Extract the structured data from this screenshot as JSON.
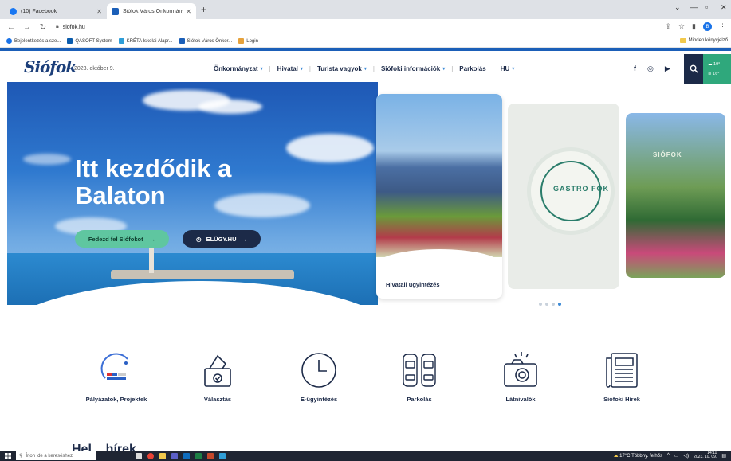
{
  "browser": {
    "tabs": [
      {
        "title": "(10) Facebook",
        "color": "#1877f2"
      },
      {
        "title": "Siófok Város Önkormányzata - ...",
        "color": "#1b5fb8"
      }
    ],
    "url": "siofok.hu",
    "bookmarks": [
      {
        "label": "Bejelentkezés a sze...",
        "color": "#1a73e8"
      },
      {
        "label": "QASOFT System",
        "color": "#0b5cad"
      },
      {
        "label": "KRÉTA Iskolai Alapr...",
        "color": "#2f9ed8"
      },
      {
        "label": "Siófok Város Önkor...",
        "color": "#1b5fb8"
      },
      {
        "label": "Login",
        "color": "#e6a23c"
      }
    ],
    "bookmarks_right": "Minden könyvjelző"
  },
  "header": {
    "logo": "Siófok",
    "date": "2023. október 9.",
    "nav": [
      {
        "label": "Önkormányzat",
        "dropdown": true
      },
      {
        "label": "Hivatal",
        "dropdown": true
      },
      {
        "label": "Turista vagyok",
        "dropdown": true
      },
      {
        "label": "Siófoki információk",
        "dropdown": true
      },
      {
        "label": "Parkolás",
        "dropdown": false
      },
      {
        "label": "HU",
        "dropdown": true
      }
    ],
    "weather": {
      "line1": "19°",
      "line2": "16°"
    }
  },
  "hero": {
    "title_line1": "Itt kezdődik a",
    "title_line2": "Balaton",
    "btn_primary": "Fedezd fel Siófokot",
    "btn_secondary": "ELÜGY.HU"
  },
  "cards": {
    "card1_caption": "Hivatali ügyintézés",
    "card2_logo": "GASTRO FOK",
    "card3_label": "SIÓFOK"
  },
  "slider": {
    "count": 4,
    "active": 3
  },
  "quick_links": [
    {
      "label": "Pályázatok, Projektek",
      "icon": "projects-logo-icon"
    },
    {
      "label": "Választás",
      "icon": "ballot-box-icon"
    },
    {
      "label": "E-ügyintézés",
      "icon": "clock-icon"
    },
    {
      "label": "Parkolás",
      "icon": "parking-cars-icon"
    },
    {
      "label": "Látnivalók",
      "icon": "camera-icon"
    },
    {
      "label": "Siófoki Hírek",
      "icon": "newspaper-icon"
    }
  ],
  "partial_section_title": "Hel... hírek",
  "taskbar": {
    "search_placeholder": "Írjon ide a kereséshez",
    "weather": "17°C  Többny. felhős",
    "time": "14:11",
    "date": "2023. 10. 09."
  }
}
